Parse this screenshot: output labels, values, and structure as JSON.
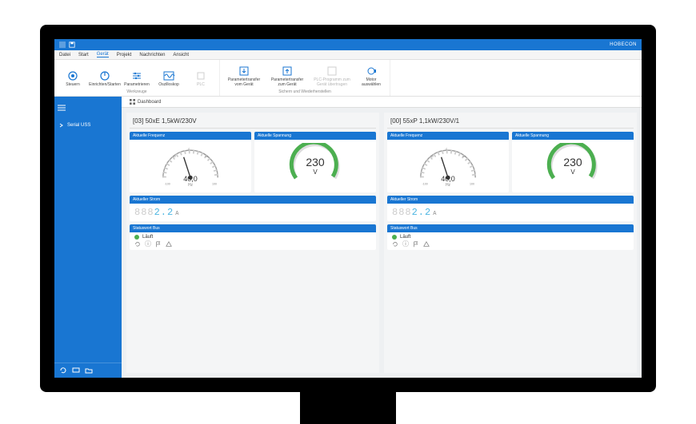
{
  "titlebar": {
    "app": "HOBECON"
  },
  "menubar": {
    "items": [
      "Datei",
      "Start",
      "Gerät",
      "Projekt",
      "Nachrichten",
      "Ansicht"
    ],
    "active_index": 2
  },
  "ribbon": {
    "group1": {
      "label": "Werkzeuge",
      "buttons": [
        "Steuern",
        "Einrichten/Starten",
        "Parametrieren",
        "Oszilloskop",
        "PLC"
      ]
    },
    "group2": {
      "label": "Sichern und Wiederherstellen",
      "buttons": [
        "Parametertransfer vom Gerät",
        "Parametertransfer zum Gerät",
        "PLC-Programm zum Gerät übertragen",
        "Motor auswählen"
      ]
    }
  },
  "sidebar": {
    "item": "Serial USS"
  },
  "tab": {
    "icon": "grid",
    "label": "Dashboard"
  },
  "panels": [
    {
      "title": "[03] 50xE 1,5kW/230V",
      "freq": {
        "header": "Aktuelle Frequenz",
        "value": "40,0",
        "unit": "Hz",
        "min": "-100",
        "max": "100",
        "needle_angle": -18
      },
      "volt": {
        "header": "Aktuelle Spannung",
        "value": "230",
        "unit": "V"
      },
      "curr": {
        "header": "Aktueller Strom",
        "ghost": "888",
        "value": "2.2",
        "unit": "A"
      },
      "status": {
        "header": "Statuswort Bus",
        "text": "Läuft"
      }
    },
    {
      "title": "[00] 55xP 1,1kW/230V/1",
      "freq": {
        "header": "Aktuelle Frequenz",
        "value": "40,0",
        "unit": "Hz",
        "min": "-100",
        "max": "100",
        "needle_angle": -18
      },
      "volt": {
        "header": "Aktuelle Spannung",
        "value": "230",
        "unit": "V"
      },
      "curr": {
        "header": "Aktueller Strom",
        "ghost": "888",
        "value": "2.2",
        "unit": "A"
      },
      "status": {
        "header": "Statuswort Bus",
        "text": "Läuft"
      }
    }
  ]
}
